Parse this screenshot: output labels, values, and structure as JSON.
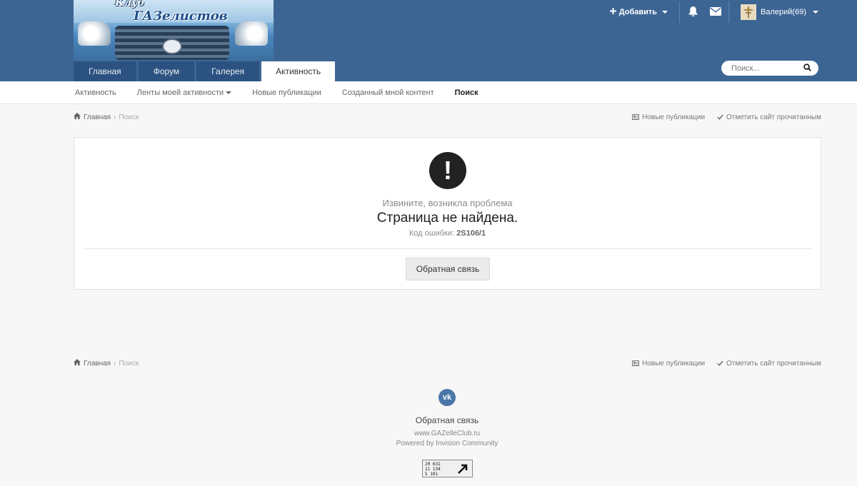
{
  "header": {
    "logo_text_line1": "Клуб",
    "logo_text_line2": "ГАЗелистов",
    "add_label": "Добавить",
    "user_label": "Валерий(69)"
  },
  "nav": {
    "tabs": [
      {
        "label": "Главная"
      },
      {
        "label": "Форум"
      },
      {
        "label": "Галерея"
      },
      {
        "label": "Активность",
        "active": true
      }
    ]
  },
  "search": {
    "placeholder": "Поиск..."
  },
  "subnav": {
    "items": [
      {
        "label": "Активность"
      },
      {
        "label": "Ленты моей активности",
        "has_caret": true
      },
      {
        "label": "Новые публикации"
      },
      {
        "label": "Созданный мной контент"
      },
      {
        "label": "Поиск",
        "active": true
      }
    ]
  },
  "breadcrumb": {
    "home": "Главная",
    "current": "Поиск",
    "new_posts": "Новые публикации",
    "mark_read": "Отметить сайт прочитанным"
  },
  "error": {
    "sorry": "Извините, возникла проблема",
    "title": "Страница не найдена.",
    "code_label": "Код ошибки:",
    "code": "2S106/1",
    "button": "Обратная связь"
  },
  "footer": {
    "vk_icon": "vk-icon",
    "feedback": "Обратная связь",
    "site": "www.GAZelleClub.ru",
    "powered": "Powered by Invision Community",
    "counter_line1": "20 631",
    "counter_line2": "11 134",
    "counter_line3": "5 101"
  },
  "colors": {
    "header_bg": "#3d6594",
    "tab_bg": "#2c5281",
    "vk_blue": "#4a76a8"
  }
}
